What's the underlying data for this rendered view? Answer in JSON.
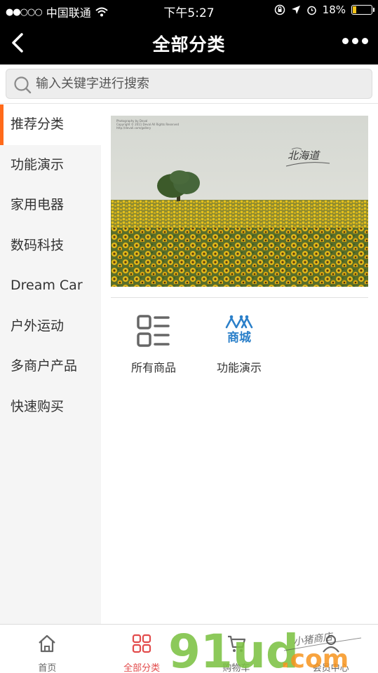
{
  "status_bar": {
    "signal": "●●○○○",
    "carrier": "中国联通",
    "time": "下午5:27",
    "battery_pct_text": "18%",
    "battery_level": 0.18
  },
  "nav": {
    "title": "全部分类"
  },
  "search": {
    "placeholder": "输入关键字进行搜索"
  },
  "sidebar": {
    "items": [
      {
        "label": "推荐分类"
      },
      {
        "label": "功能演示"
      },
      {
        "label": "家用电器"
      },
      {
        "label": "数码科技"
      },
      {
        "label": "Dream Car"
      },
      {
        "label": "户外运动"
      },
      {
        "label": "多商户产品"
      },
      {
        "label": "快速购买"
      }
    ],
    "active_index": 0
  },
  "banner": {
    "logo_text": "北海道",
    "caption_lines": [
      "Photography by Deval",
      "Copyright © 2011 Deval All Rights Reserved",
      "http://devall.com/gallery"
    ]
  },
  "categories": [
    {
      "label": "所有商品",
      "icon": "list-grid-icon"
    },
    {
      "label": "功能演示",
      "icon": "mall-logo-icon",
      "icon_text": "商城"
    }
  ],
  "tab_bar": {
    "items": [
      {
        "label": "首页",
        "icon": "home-icon"
      },
      {
        "label": "全部分类",
        "icon": "grid-icon"
      },
      {
        "label": "购物车",
        "icon": "cart-icon"
      },
      {
        "label": "会员中心",
        "icon": "user-icon"
      }
    ],
    "active_index": 1
  },
  "watermark": {
    "main": "91ud",
    "suffix": ".com",
    "handwritten": "小猪商店"
  },
  "colors": {
    "accent": "#ff6a1a",
    "tab_active": "#e24b4b",
    "mall_blue": "#2a7fc9",
    "watermark_green": "#7cc243",
    "watermark_orange": "#f7941d"
  }
}
